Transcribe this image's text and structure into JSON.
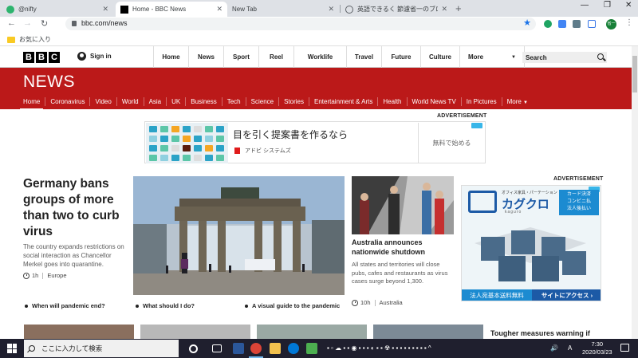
{
  "browser": {
    "tabs": [
      {
        "title": "@nifty",
        "active": false
      },
      {
        "title": "Home - BBC News",
        "active": true
      },
      {
        "title": "New Tab",
        "active": false
      },
      {
        "title": "英語できるく 節濾省一のブログ",
        "active": false
      }
    ],
    "new_tab_symbol": "+",
    "url": "bbc.com/news",
    "profile_label": "省一",
    "bookmark_folder": "お気に入り"
  },
  "bbc": {
    "logo_letters": [
      "B",
      "B",
      "C"
    ],
    "sign_in": "Sign in",
    "nav": [
      "Home",
      "News",
      "Sport",
      "Reel",
      "Worklife",
      "Travel",
      "Future",
      "Culture",
      "More"
    ],
    "search_placeholder": "Search",
    "news_logo": "NEWS",
    "subnav": [
      "Home",
      "Coronavirus",
      "Video",
      "World",
      "Asia",
      "UK",
      "Business",
      "Tech",
      "Science",
      "Stories",
      "Entertainment & Arts",
      "Health",
      "World News TV",
      "In Pictures",
      "More"
    ],
    "subnav_active": "Home"
  },
  "ads": {
    "label": "ADVERTISEMENT",
    "top": {
      "headline": "目を引く提案書を作るなら",
      "vendor": "アドビ システムズ",
      "cta": "無料で始める"
    },
    "side": {
      "brand_small": "オフィス家具・パーテーション",
      "brand": "カグクロ",
      "brand_sub": "kaguro",
      "badge_lines": [
        "カード決済",
        "コンビニ払",
        "法人後払い"
      ],
      "footer_left": "法人宛基本送料無料",
      "footer_right": "サイトにアクセス"
    }
  },
  "lead": {
    "title": "Germany bans groups of more than two to curb virus",
    "summary": "The country expands restrictions on social interaction as Chancellor Merkel goes into quarantine.",
    "time": "1h",
    "section": "Europe"
  },
  "side_story": {
    "title": "Australia announces nationwide shutdown",
    "summary": "All states and territories will close pubs, cafes and restaurants as virus cases surge beyond 1,300.",
    "time": "10h",
    "section": "Australia"
  },
  "related": [
    "When will pandemic end?",
    "What should I do?",
    "A visual guide to the pandemic"
  ],
  "next_story_title": "Tougher measures warning if",
  "taskbar": {
    "search_placeholder": "ここに入力して検索",
    "time": "7:30",
    "date": "2020/03/23",
    "ime": "A"
  }
}
